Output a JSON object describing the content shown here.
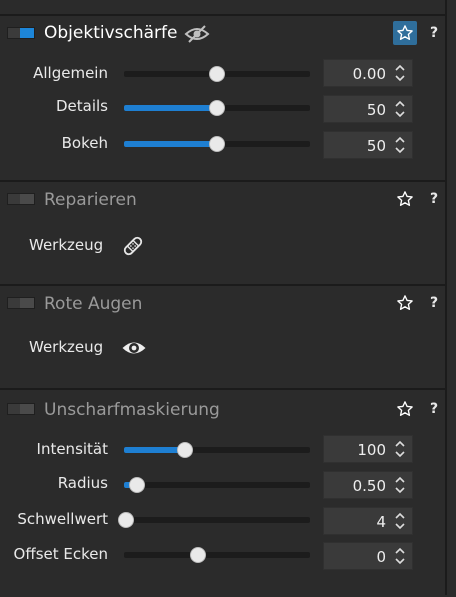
{
  "panels": [
    {
      "title": "Objektivschärfe",
      "enabled": true,
      "favorite": true,
      "help": "?",
      "sliders": [
        {
          "label": "Allgemein",
          "value": "0.00",
          "fraction": 0.5,
          "fill": false
        },
        {
          "label": "Details",
          "value": "50",
          "fraction": 0.5,
          "fill": true
        },
        {
          "label": "Bokeh",
          "value": "50",
          "fraction": 0.5,
          "fill": true
        }
      ]
    },
    {
      "title": "Reparieren",
      "enabled": false,
      "favorite": false,
      "help": "?",
      "tool_label": "Werkzeug",
      "tool_icon": "bandage-icon"
    },
    {
      "title": "Rote Augen",
      "enabled": false,
      "favorite": false,
      "help": "?",
      "tool_label": "Werkzeug",
      "tool_icon": "eye-icon"
    },
    {
      "title": "Unscharfmaskierung",
      "enabled": false,
      "favorite": false,
      "help": "?",
      "sliders": [
        {
          "label": "Intensität",
          "value": "100",
          "fraction": 0.33,
          "fill": true
        },
        {
          "label": "Radius",
          "value": "0.50",
          "fraction": 0.07,
          "fill": true
        },
        {
          "label": "Schwellwert",
          "value": "4",
          "fraction": 0.01,
          "fill": false
        },
        {
          "label": "Offset Ecken",
          "value": "0",
          "fraction": 0.4,
          "fill": false
        }
      ]
    }
  ],
  "colors": {
    "accent": "#1e7fd2",
    "favorite_bg": "#2f6e9b",
    "background": "#2b2b2b"
  }
}
